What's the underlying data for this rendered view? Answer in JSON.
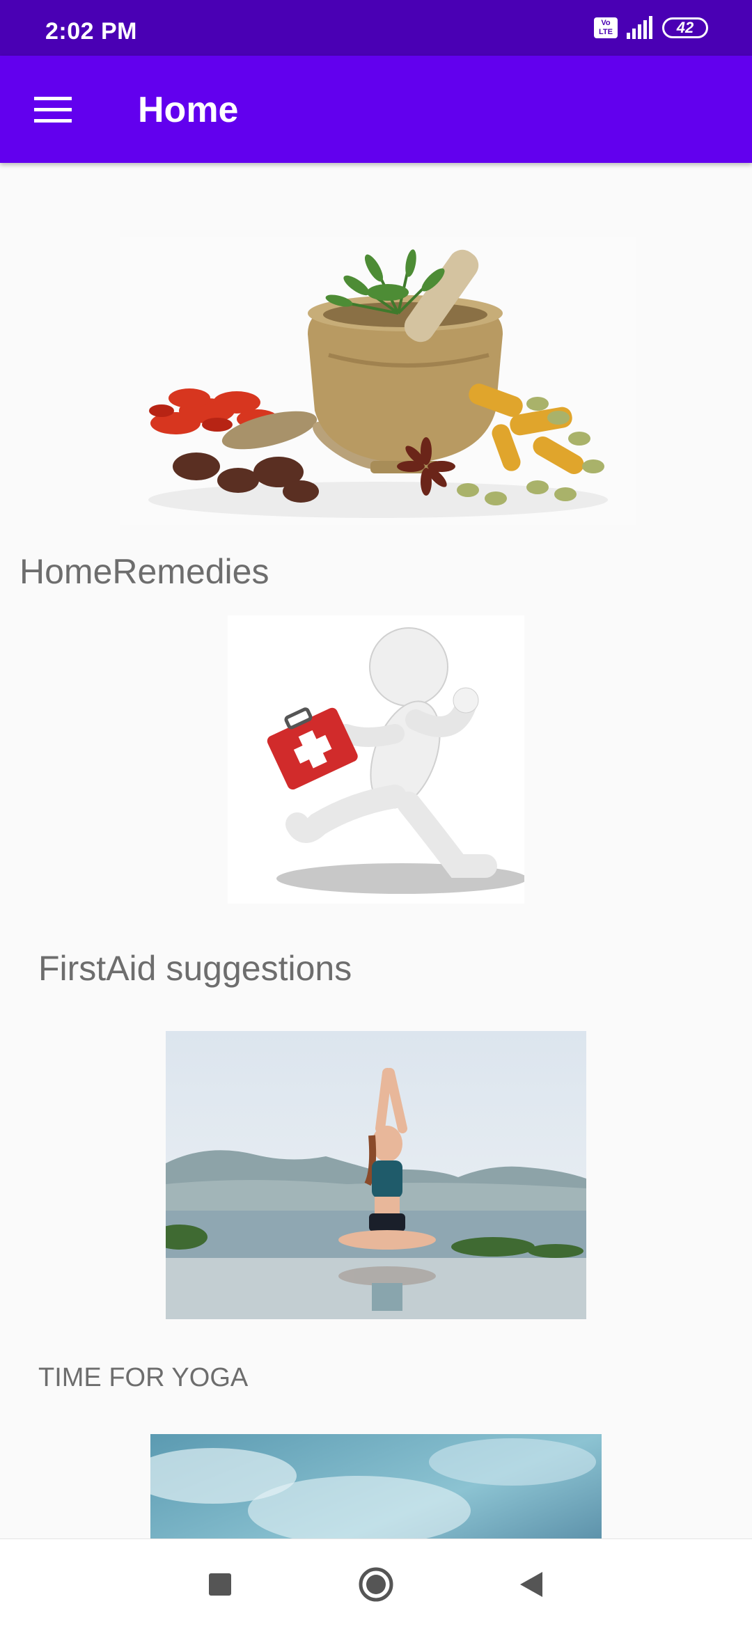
{
  "status_bar": {
    "time": "2:02 PM",
    "volte_label": "Vo LTE",
    "battery_level": "42",
    "icons": [
      "volte-icon",
      "signal-icon",
      "battery-icon"
    ]
  },
  "app_bar": {
    "title": "Home",
    "menu_icon": "hamburger-menu-icon",
    "background_color": "#6200ee"
  },
  "sections": [
    {
      "caption": "HomeRemedies",
      "image": "herbs-and-spices-mortar-image"
    },
    {
      "caption": "FirstAid suggestions",
      "image": "running-figure-first-aid-kit-image"
    },
    {
      "caption": "TIME FOR YOGA",
      "image": "yoga-woman-meditating-image"
    },
    {
      "caption": "",
      "image": "cloudy-sky-image"
    }
  ],
  "nav_bar": {
    "buttons": [
      "recents-square-icon",
      "home-circle-icon",
      "back-triangle-icon"
    ]
  }
}
